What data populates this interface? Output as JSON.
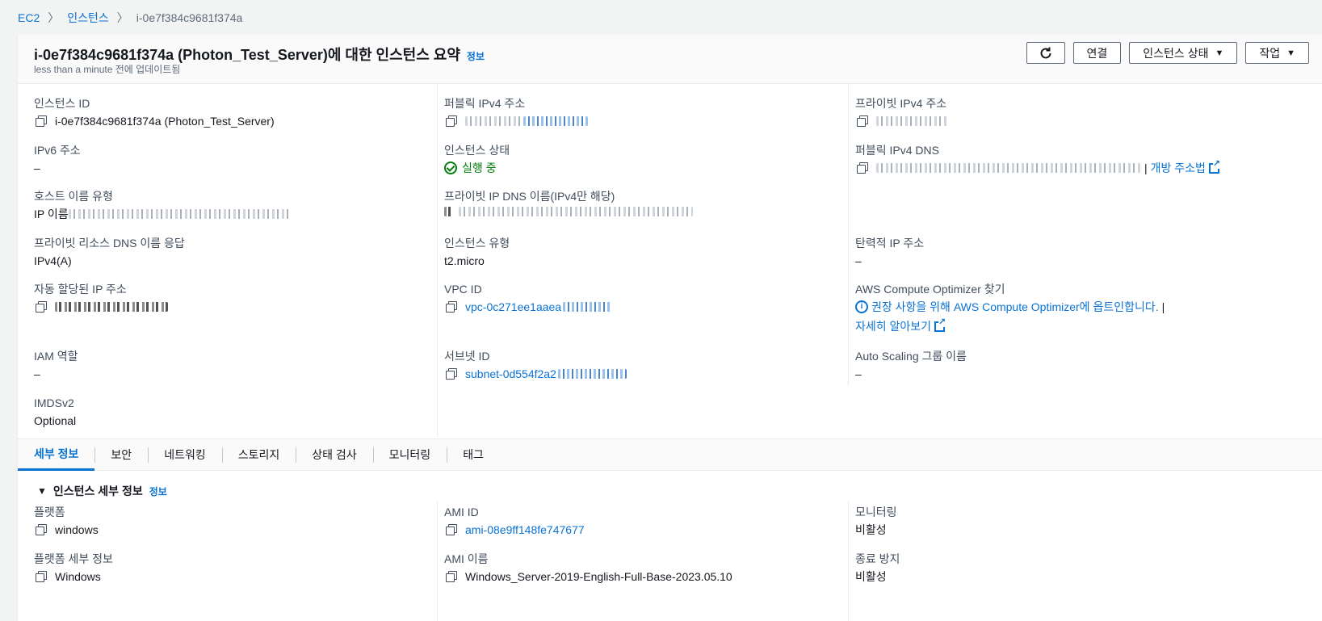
{
  "breadcrumb": {
    "ec2": "EC2",
    "instances": "인스턴스",
    "current": "i-0e7f384c9681f374a"
  },
  "header": {
    "title": "i-0e7f384c9681f374a (Photon_Test_Server)에 대한 인스턴스 요약",
    "info": "정보",
    "updated": "less than a minute 전에 업데이트됨",
    "btn_connect": "연결",
    "btn_state": "인스턴스 상태",
    "btn_actions": "작업"
  },
  "summary": {
    "instance_id_label": "인스턴스 ID",
    "instance_id_value": "i-0e7f384c9681f374a (Photon_Test_Server)",
    "public_ipv4_label": "퍼블릭 IPv4 주소",
    "private_ipv4_label": "프라이빗 IPv4 주소",
    "ipv6_label": "IPv6 주소",
    "ipv6_value": "–",
    "state_label": "인스턴스 상태",
    "state_value": "실행 중",
    "public_dns_label": "퍼블릭 IPv4 DNS",
    "public_dns_link": "개방 주소법",
    "hostname_type_label": "호스트 이름 유형",
    "hostname_type_prefix": "IP 이름",
    "private_dns_label": "프라이빗 IP DNS 이름(IPv4만 해당)",
    "private_resource_dns_label": "프라이빗 리소스 DNS 이름 응답",
    "private_resource_dns_value": "IPv4(A)",
    "instance_type_label": "인스턴스 유형",
    "instance_type_value": "t2.micro",
    "elastic_ip_label": "탄력적 IP 주소",
    "elastic_ip_value": "–",
    "auto_ip_label": "자동 할당된 IP 주소",
    "vpc_label": "VPC ID",
    "vpc_value": "vpc-0c271ee1aaea",
    "optimizer_label": "AWS Compute Optimizer 찾기",
    "optimizer_text": "권장 사항을 위해 AWS Compute Optimizer에 옵트인합니다.",
    "optimizer_sep": "|",
    "optimizer_learn": "자세히 알아보기",
    "iam_label": "IAM 역할",
    "iam_value": "–",
    "subnet_label": "서브넷 ID",
    "subnet_value": "subnet-0d554f2a2",
    "asg_label": "Auto Scaling 그룹 이름",
    "asg_value": "–",
    "imds_label": "IMDSv2",
    "imds_value": "Optional"
  },
  "tabs": [
    "세부 정보",
    "보안",
    "네트워킹",
    "스토리지",
    "상태 검사",
    "모니터링",
    "태그"
  ],
  "details": {
    "title": "인스턴스 세부 정보",
    "info": "정보",
    "platform_label": "플랫폼",
    "platform_value": "windows",
    "ami_id_label": "AMI ID",
    "ami_id_value": "ami-08e9ff148fe747677",
    "monitoring_label": "모니터링",
    "monitoring_value": "비활성",
    "platform_detail_label": "플랫폼 세부 정보",
    "platform_detail_value": "Windows",
    "ami_name_label": "AMI 이름",
    "ami_name_value": "Windows_Server-2019-English-Full-Base-2023.05.10",
    "termination_label": "종료 방지",
    "termination_value": "비활성"
  }
}
